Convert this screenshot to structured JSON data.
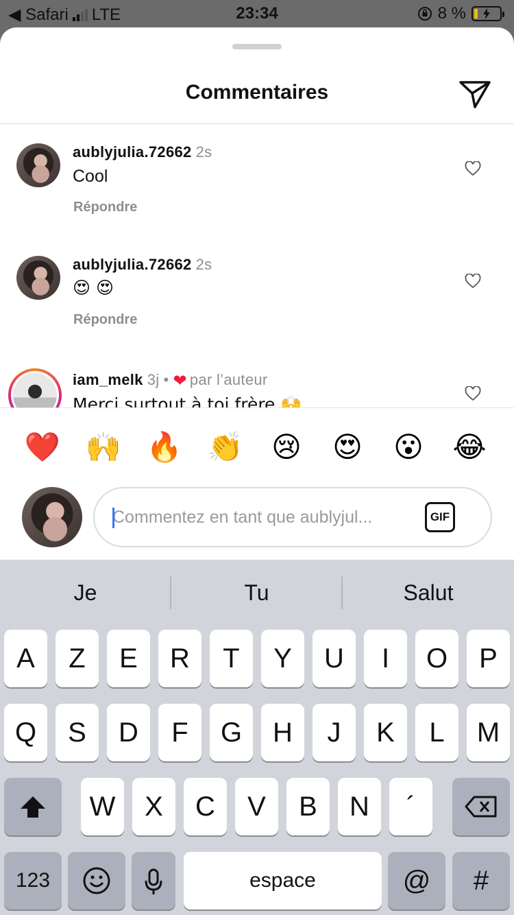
{
  "status_bar": {
    "back_label": "◀ Safari",
    "network": "LTE",
    "time": "23:34",
    "battery": "8 %"
  },
  "sheet": {
    "title": "Commentaires"
  },
  "comments": [
    {
      "username": "aublyjulia.72662",
      "time": "2s",
      "text": "Cool",
      "reply": "Répondre"
    },
    {
      "username": "aublyjulia.72662",
      "time": "2s",
      "text": "😍 😍",
      "reply": "Répondre"
    },
    {
      "username": "iam_melk",
      "time": "3j",
      "separator": "•",
      "liked_label": "par l’auteur",
      "text": "Merci surtout à toi frère 🙌"
    }
  ],
  "emoji_bar": [
    "❤️",
    "🙌",
    "🔥",
    "👏",
    "😢",
    "😍",
    "😮",
    "😂"
  ],
  "input": {
    "placeholder": "Commentez en tant que aublyjul...",
    "gif_label": "GIF"
  },
  "keyboard": {
    "suggestions": [
      "Je",
      "Tu",
      "Salut"
    ],
    "row1": [
      "A",
      "Z",
      "E",
      "R",
      "T",
      "Y",
      "U",
      "I",
      "O",
      "P"
    ],
    "row2": [
      "Q",
      "S",
      "D",
      "F",
      "G",
      "H",
      "J",
      "K",
      "L",
      "M"
    ],
    "row3": [
      "W",
      "X",
      "C",
      "V",
      "B",
      "N",
      "´"
    ],
    "numbers_label": "123",
    "space_label": "espace",
    "at_label": "@",
    "hash_label": "#"
  },
  "colors": {
    "accent_blue": "#3478f6",
    "heart_red": "#ed1c3c",
    "keyboard_bg": "#d1d4db"
  }
}
